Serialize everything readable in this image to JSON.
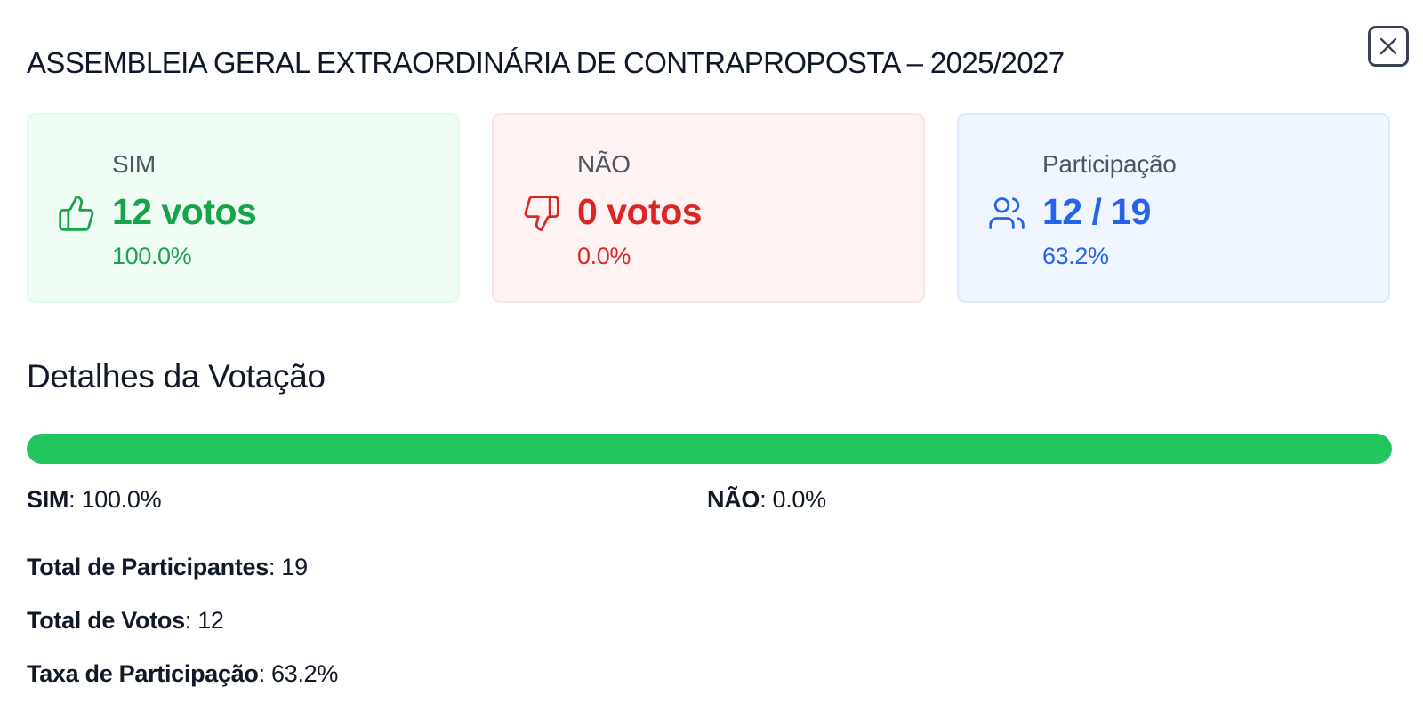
{
  "modal": {
    "title": "ASSEMBLEIA GERAL EXTRAORDINÁRIA DE CONTRAPROPOSTA – 2025/2027",
    "close_icon": "close-icon"
  },
  "cards": {
    "yes": {
      "label": "SIM",
      "value": "12 votos",
      "percent": "100.0%",
      "icon": "thumbs-up-icon",
      "color": "#16a34a"
    },
    "no": {
      "label": "NÃO",
      "value": "0 votos",
      "percent": "0.0%",
      "icon": "thumbs-down-icon",
      "color": "#dc2626"
    },
    "participation": {
      "label": "Participação",
      "value": "12 / 19",
      "percent": "63.2%",
      "icon": "users-icon",
      "color": "#2563eb"
    }
  },
  "details": {
    "title": "Detalhes da Votação",
    "bar": {
      "yes_fraction": 1.0,
      "fill_color": "#22c55e"
    },
    "yes_label": "SIM",
    "yes_value": "100.0%",
    "no_label": "NÃO",
    "no_value": "0.0%",
    "stats": [
      {
        "label": "Total de Participantes",
        "value": "19"
      },
      {
        "label": "Total de Votos",
        "value": "12"
      },
      {
        "label": "Taxa de Participação",
        "value": "63.2%"
      }
    ]
  }
}
